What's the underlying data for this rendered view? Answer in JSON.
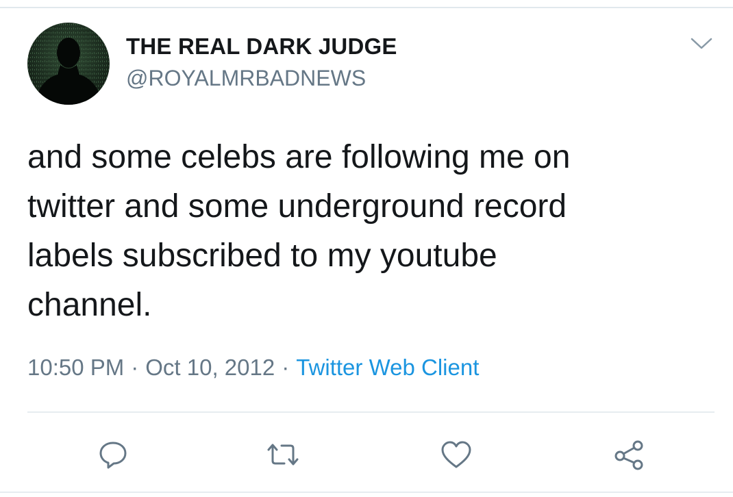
{
  "tweet": {
    "author": {
      "display_name": "THE REAL DARK JUDGE",
      "handle": "@ROYALMRBADNEWS",
      "avatar_icon": "silhouette-avatar"
    },
    "text": "and some celebs are following me on\ntwitter and some underground record\nlabels subscribed to my youtube\nchannel.",
    "time": "10:50 PM",
    "date": "Oct 10, 2012",
    "separator": "·",
    "client": "Twitter Web Client"
  },
  "actions": [
    {
      "name": "reply",
      "icon": "speech-bubble-icon"
    },
    {
      "name": "retweet",
      "icon": "retweet-arrows-icon"
    },
    {
      "name": "like",
      "icon": "heart-icon"
    },
    {
      "name": "share",
      "icon": "share-nodes-icon"
    }
  ],
  "colors": {
    "text_primary": "#14171a",
    "text_secondary": "#657786",
    "link": "#1b95e0",
    "divider": "#e6ecf0"
  }
}
